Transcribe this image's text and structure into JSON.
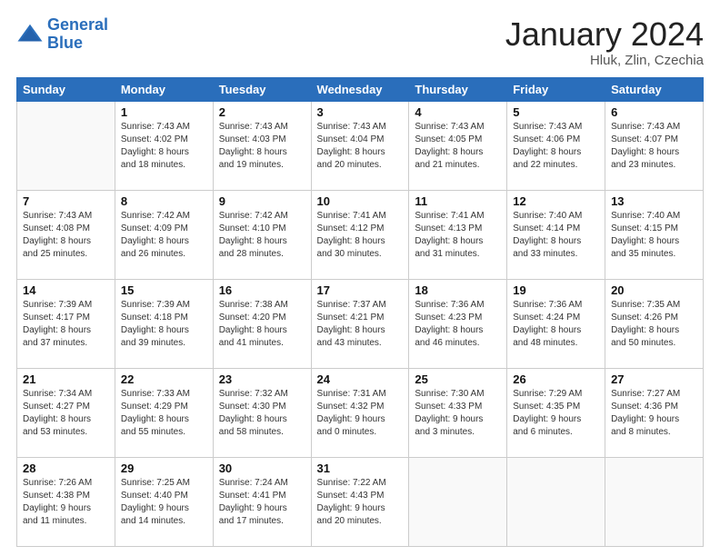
{
  "header": {
    "logo_line1": "General",
    "logo_line2": "Blue",
    "title": "January 2024",
    "subtitle": "Hluk, Zlin, Czechia"
  },
  "days_of_week": [
    "Sunday",
    "Monday",
    "Tuesday",
    "Wednesday",
    "Thursday",
    "Friday",
    "Saturday"
  ],
  "weeks": [
    [
      {
        "day": "",
        "info": ""
      },
      {
        "day": "1",
        "info": "Sunrise: 7:43 AM\nSunset: 4:02 PM\nDaylight: 8 hours\nand 18 minutes."
      },
      {
        "day": "2",
        "info": "Sunrise: 7:43 AM\nSunset: 4:03 PM\nDaylight: 8 hours\nand 19 minutes."
      },
      {
        "day": "3",
        "info": "Sunrise: 7:43 AM\nSunset: 4:04 PM\nDaylight: 8 hours\nand 20 minutes."
      },
      {
        "day": "4",
        "info": "Sunrise: 7:43 AM\nSunset: 4:05 PM\nDaylight: 8 hours\nand 21 minutes."
      },
      {
        "day": "5",
        "info": "Sunrise: 7:43 AM\nSunset: 4:06 PM\nDaylight: 8 hours\nand 22 minutes."
      },
      {
        "day": "6",
        "info": "Sunrise: 7:43 AM\nSunset: 4:07 PM\nDaylight: 8 hours\nand 23 minutes."
      }
    ],
    [
      {
        "day": "7",
        "info": "Sunrise: 7:43 AM\nSunset: 4:08 PM\nDaylight: 8 hours\nand 25 minutes."
      },
      {
        "day": "8",
        "info": "Sunrise: 7:42 AM\nSunset: 4:09 PM\nDaylight: 8 hours\nand 26 minutes."
      },
      {
        "day": "9",
        "info": "Sunrise: 7:42 AM\nSunset: 4:10 PM\nDaylight: 8 hours\nand 28 minutes."
      },
      {
        "day": "10",
        "info": "Sunrise: 7:41 AM\nSunset: 4:12 PM\nDaylight: 8 hours\nand 30 minutes."
      },
      {
        "day": "11",
        "info": "Sunrise: 7:41 AM\nSunset: 4:13 PM\nDaylight: 8 hours\nand 31 minutes."
      },
      {
        "day": "12",
        "info": "Sunrise: 7:40 AM\nSunset: 4:14 PM\nDaylight: 8 hours\nand 33 minutes."
      },
      {
        "day": "13",
        "info": "Sunrise: 7:40 AM\nSunset: 4:15 PM\nDaylight: 8 hours\nand 35 minutes."
      }
    ],
    [
      {
        "day": "14",
        "info": "Sunrise: 7:39 AM\nSunset: 4:17 PM\nDaylight: 8 hours\nand 37 minutes."
      },
      {
        "day": "15",
        "info": "Sunrise: 7:39 AM\nSunset: 4:18 PM\nDaylight: 8 hours\nand 39 minutes."
      },
      {
        "day": "16",
        "info": "Sunrise: 7:38 AM\nSunset: 4:20 PM\nDaylight: 8 hours\nand 41 minutes."
      },
      {
        "day": "17",
        "info": "Sunrise: 7:37 AM\nSunset: 4:21 PM\nDaylight: 8 hours\nand 43 minutes."
      },
      {
        "day": "18",
        "info": "Sunrise: 7:36 AM\nSunset: 4:23 PM\nDaylight: 8 hours\nand 46 minutes."
      },
      {
        "day": "19",
        "info": "Sunrise: 7:36 AM\nSunset: 4:24 PM\nDaylight: 8 hours\nand 48 minutes."
      },
      {
        "day": "20",
        "info": "Sunrise: 7:35 AM\nSunset: 4:26 PM\nDaylight: 8 hours\nand 50 minutes."
      }
    ],
    [
      {
        "day": "21",
        "info": "Sunrise: 7:34 AM\nSunset: 4:27 PM\nDaylight: 8 hours\nand 53 minutes."
      },
      {
        "day": "22",
        "info": "Sunrise: 7:33 AM\nSunset: 4:29 PM\nDaylight: 8 hours\nand 55 minutes."
      },
      {
        "day": "23",
        "info": "Sunrise: 7:32 AM\nSunset: 4:30 PM\nDaylight: 8 hours\nand 58 minutes."
      },
      {
        "day": "24",
        "info": "Sunrise: 7:31 AM\nSunset: 4:32 PM\nDaylight: 9 hours\nand 0 minutes."
      },
      {
        "day": "25",
        "info": "Sunrise: 7:30 AM\nSunset: 4:33 PM\nDaylight: 9 hours\nand 3 minutes."
      },
      {
        "day": "26",
        "info": "Sunrise: 7:29 AM\nSunset: 4:35 PM\nDaylight: 9 hours\nand 6 minutes."
      },
      {
        "day": "27",
        "info": "Sunrise: 7:27 AM\nSunset: 4:36 PM\nDaylight: 9 hours\nand 8 minutes."
      }
    ],
    [
      {
        "day": "28",
        "info": "Sunrise: 7:26 AM\nSunset: 4:38 PM\nDaylight: 9 hours\nand 11 minutes."
      },
      {
        "day": "29",
        "info": "Sunrise: 7:25 AM\nSunset: 4:40 PM\nDaylight: 9 hours\nand 14 minutes."
      },
      {
        "day": "30",
        "info": "Sunrise: 7:24 AM\nSunset: 4:41 PM\nDaylight: 9 hours\nand 17 minutes."
      },
      {
        "day": "31",
        "info": "Sunrise: 7:22 AM\nSunset: 4:43 PM\nDaylight: 9 hours\nand 20 minutes."
      },
      {
        "day": "",
        "info": ""
      },
      {
        "day": "",
        "info": ""
      },
      {
        "day": "",
        "info": ""
      }
    ]
  ]
}
